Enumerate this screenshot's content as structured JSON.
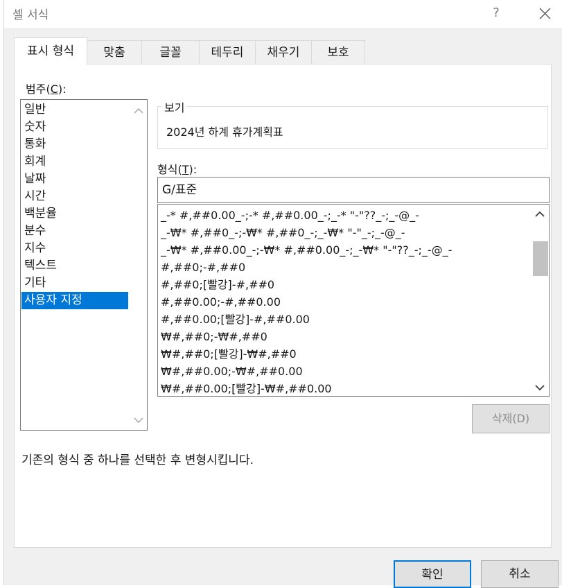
{
  "window": {
    "title": "셀 서식",
    "help": "?"
  },
  "tabs": [
    {
      "label": "표시 형식",
      "active": true
    },
    {
      "label": "맞춤"
    },
    {
      "label": "글꼴"
    },
    {
      "label": "테두리"
    },
    {
      "label": "채우기"
    },
    {
      "label": "보호"
    }
  ],
  "category": {
    "label_prefix": "범주(",
    "label_key": "C",
    "label_suffix": "):",
    "items": [
      "일반",
      "숫자",
      "통화",
      "회계",
      "날짜",
      "시간",
      "백분율",
      "분수",
      "지수",
      "텍스트",
      "기타",
      "사용자 지정"
    ],
    "selected": "사용자 지정"
  },
  "preview": {
    "legend": "보기",
    "value": "2024년 하계 휴가계획표"
  },
  "format": {
    "label_prefix": "형식(",
    "label_key": "T",
    "label_suffix": "):",
    "input_value": "G/표준",
    "items": [
      "_-* #,##0.00_-;-* #,##0.00_-;_-* \"-\"??_-;_-@_-",
      "_-₩* #,##0_-;-₩* #,##0_-;_-₩* \"-\"_-;_-@_-",
      "_-₩* #,##0.00_-;-₩* #,##0.00_-;_-₩* \"-\"??_-;_-@_-",
      "#,##0;-#,##0",
      "#,##0;[빨강]-#,##0",
      "#,##0.00;-#,##0.00",
      "#,##0.00;[빨강]-#,##0.00",
      "₩#,##0;-₩#,##0",
      "₩#,##0;[빨강]-₩#,##0",
      "₩#,##0.00;-₩#,##0.00",
      "₩#,##0.00;[빨강]-₩#,##0.00"
    ]
  },
  "buttons": {
    "delete": "삭제(D)",
    "ok": "확인",
    "cancel": "취소"
  },
  "description": "기존의 형식 중 하나를 선택한 후 변형시킵니다.",
  "colors": {
    "selection": "#0078d7",
    "dialog_bg": "#f0f0f0",
    "disabled_text": "#8c8c8c"
  }
}
